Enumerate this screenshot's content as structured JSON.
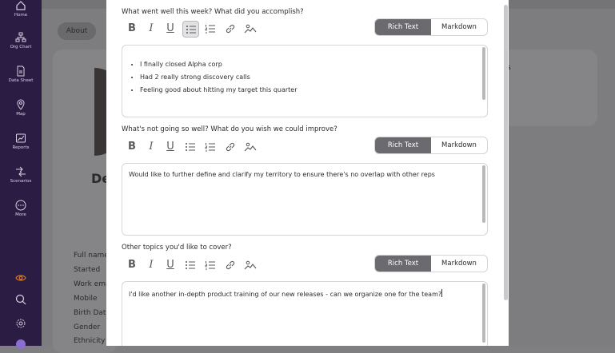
{
  "nav": {
    "items": [
      {
        "label": "Home",
        "icon": "home-icon"
      },
      {
        "label": "Org Chart",
        "icon": "org-chart-icon"
      },
      {
        "label": "Data Sheet",
        "icon": "data-sheet-icon"
      },
      {
        "label": "Map",
        "icon": "map-pin-icon"
      },
      {
        "label": "Reports",
        "icon": "reports-icon"
      },
      {
        "label": "Scenarios",
        "icon": "scenarios-icon"
      },
      {
        "label": "More",
        "icon": "more-icon"
      }
    ],
    "bottom_icons": [
      "eye-icon",
      "search-icon",
      "settings-icon",
      "profile-icon"
    ],
    "accent_color": "#e07a1f"
  },
  "background": {
    "tab_label": "About",
    "person_initial": "De",
    "fields": [
      "Full name",
      "Started",
      "Work ema",
      "Mobile",
      "Birth Date",
      "Gender",
      "Ethnicity"
    ],
    "right_card_char": "s"
  },
  "modal": {
    "toggle": {
      "rich_text": "Rich Text",
      "markdown": "Markdown"
    },
    "questions": [
      {
        "label": "What went well this week? What did you accomplish?",
        "bullets": [
          "I finally closed Alpha corp",
          "Had 2 really strong discovery calls",
          "Feeling good about hitting my target this quarter"
        ]
      },
      {
        "label": "What's not going so well? What do you wish we could improve?",
        "text": "Would like to further define and clarify my territory to ensure there's no overlap with other reps"
      },
      {
        "label": "Other topics you'd like to cover?",
        "text": "I'd like another in-depth product training of our new releases - can we organize one for the team?"
      }
    ],
    "toolbar": {
      "bold": "B",
      "italic": "I",
      "underline": "U",
      "icons": [
        "bold-icon",
        "italic-icon",
        "underline-icon",
        "bulleted-list-icon",
        "numbered-list-icon",
        "link-icon",
        "image-icon"
      ]
    }
  }
}
